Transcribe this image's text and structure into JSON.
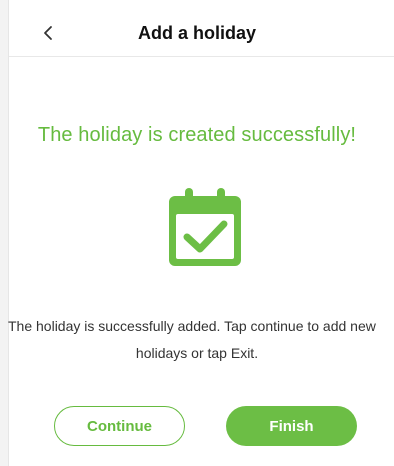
{
  "header": {
    "title": "Add a holiday",
    "back_icon": "chevron-left-icon"
  },
  "result": {
    "title": "The holiday is created successfully!",
    "icon": "calendar-check-icon",
    "message_line1": "The holiday is successfully added. Tap continue to add new",
    "message_line2": "holidays or tap Exit."
  },
  "actions": {
    "continue_label": "Continue",
    "finish_label": "Finish"
  },
  "colors": {
    "accent": "#66bb3f",
    "button_fill": "#6cbe45"
  }
}
